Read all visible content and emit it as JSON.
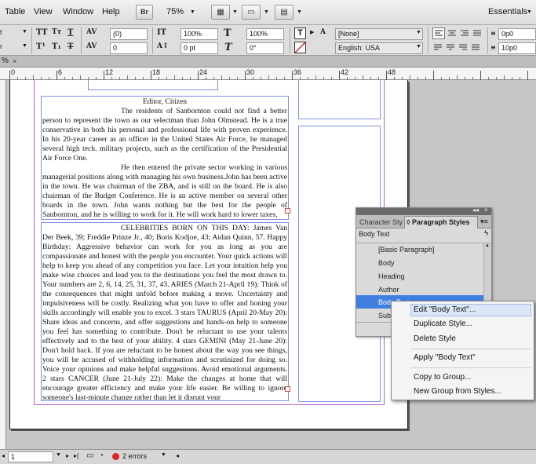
{
  "menubar": {
    "items": [
      "Table",
      "View",
      "Window",
      "Help"
    ],
    "br_label": "Br",
    "zoom": "75%",
    "workspace": "Essentials"
  },
  "control": {
    "font_size": "(0)",
    "leading": "0",
    "h_scale": "100%",
    "v_scale": "100%",
    "h_scale2": "100%",
    "v_scale2": "100%",
    "baseline": "0 pt",
    "skew": "0°",
    "char_style": "[None]",
    "language": "English: USA",
    "space_before": "0p0",
    "space_after": "10p0"
  },
  "tabstrip": {
    "tab_label": "%"
  },
  "ruler": {
    "ticks": [
      "0",
      "6",
      "12",
      "18",
      "24",
      "30",
      "36",
      "42",
      "48"
    ]
  },
  "document": {
    "col1_heading": "Editor, Citizen",
    "col1_p1": "The residents of Sanbornton could not find a better person to represent the town as our selectman than John Olmstead. He is a true conservative in both his personal and professional life with proven experience. In his 20-year career as an officer in the United States Air Force, he managed several high tech. military projects, such as the certification of the Presidential Air Force One.",
    "col1_p2": "He then entered the private sector working in various managerial positions along with managing his own business.John has been active in the town. He was chairman of the ZBA, and is still on the board. He is also chairman of the Budget Conference. He is an active member on several other boards in the town. John wants nothing but the best for the people of Sanbornton, and he is willing to work for it. He will work hard to lower taxes,",
    "col2_heading": "CELEBRITIES BORN ON THIS DAY:",
    "col2_text": "James Van Der Beek, 39; Freddie Prinze Jr., 40; Boris Kodjoe, 43; Aidan Quinn, 57.    Happy Birthday: Aggressive behavior can work for you as long as you are compassionate and honest with the people you encounter. Your quick actions will help to keep you ahead of any competition you face. Let your intuition help you make wise choices and lead you to the destinations you feel the most drawn to. Your numbers are 2, 6, 14, 25, 31, 37, 43.    ARIES (March 21-April 19): Think of the consequences that might unfold before making a move. Uncertainty and impulsiveness will be costly. Realizing what you have to offer and honing your skills accordingly will enable you to excel. 3 stars    TAURUS (April 20-May 20): Share ideas and concerns, and offer suggestions and hands-on help to someone you feel has something to contribute. Don't be reluctant to use your talents effectively and to the best of your ability. 4 stars    GEMINI (May 21-June 20): Don't hold back. If you are reluctant to be honest about the way you see things, you will be accused of withholding information and scrutinized for doing so. Voice your opinions and make helpful suggestions. Avoid emotional arguments. 2 stars    CANCER (June 21-July 22): Make the changes at home that will encourage greater efficiency and make your life easier. Be willing to ignore someone's last-minute change rather than let it disrupt your"
  },
  "panel": {
    "tab_character": "Character Sty",
    "tab_paragraph": "Paragraph Styles",
    "current_style": "Body Text",
    "styles": [
      "[Basic Paragraph]",
      "Body",
      "Heading",
      "Author",
      "Body Text",
      "Subh"
    ]
  },
  "context_menu": {
    "items": [
      "Edit \"Body Text\"...",
      "Duplicate Style...",
      "Delete Style",
      "Apply \"Body Text\"",
      "Copy to Group...",
      "New Group from Styles..."
    ]
  },
  "status": {
    "page": "1",
    "errors": "2 errors"
  },
  "colors": {
    "frame": "#7f8fe0",
    "selection": "#3f7fe0",
    "error": "#d22",
    "margin": "#c05ad0"
  }
}
